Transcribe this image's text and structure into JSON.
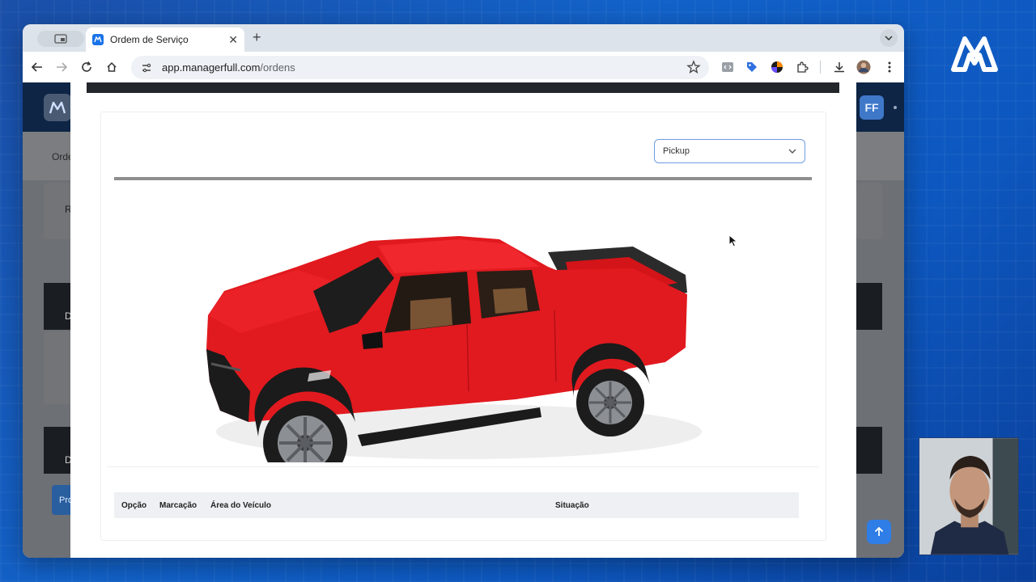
{
  "browser": {
    "tab": {
      "title": "Ordem de Serviço"
    },
    "address": {
      "host": "app.managerfull.com",
      "path": "/ordens"
    }
  },
  "app": {
    "avatar_initials": "FF",
    "breadcrumb": "Orde"
  },
  "modal": {
    "vehicle_select": {
      "value": "Pickup"
    },
    "table": {
      "headers": [
        "Opção",
        "Marcação",
        "Área do Veículo",
        "Situação"
      ]
    }
  },
  "background": {
    "letters": [
      "R",
      "D",
      "D",
      "Pro"
    ]
  },
  "colors": {
    "accent": "#2f7de6",
    "header": "#0e2546",
    "vehicle": "#e11a1f",
    "background": "#1262c9"
  },
  "icons": [
    "back-icon",
    "forward-icon",
    "reload-icon",
    "home-icon",
    "site-settings-icon",
    "bookmark-star-icon",
    "download-icon",
    "puzzle-icon",
    "chevron-down-icon",
    "arrow-up-icon",
    "brand-logo-icon"
  ]
}
